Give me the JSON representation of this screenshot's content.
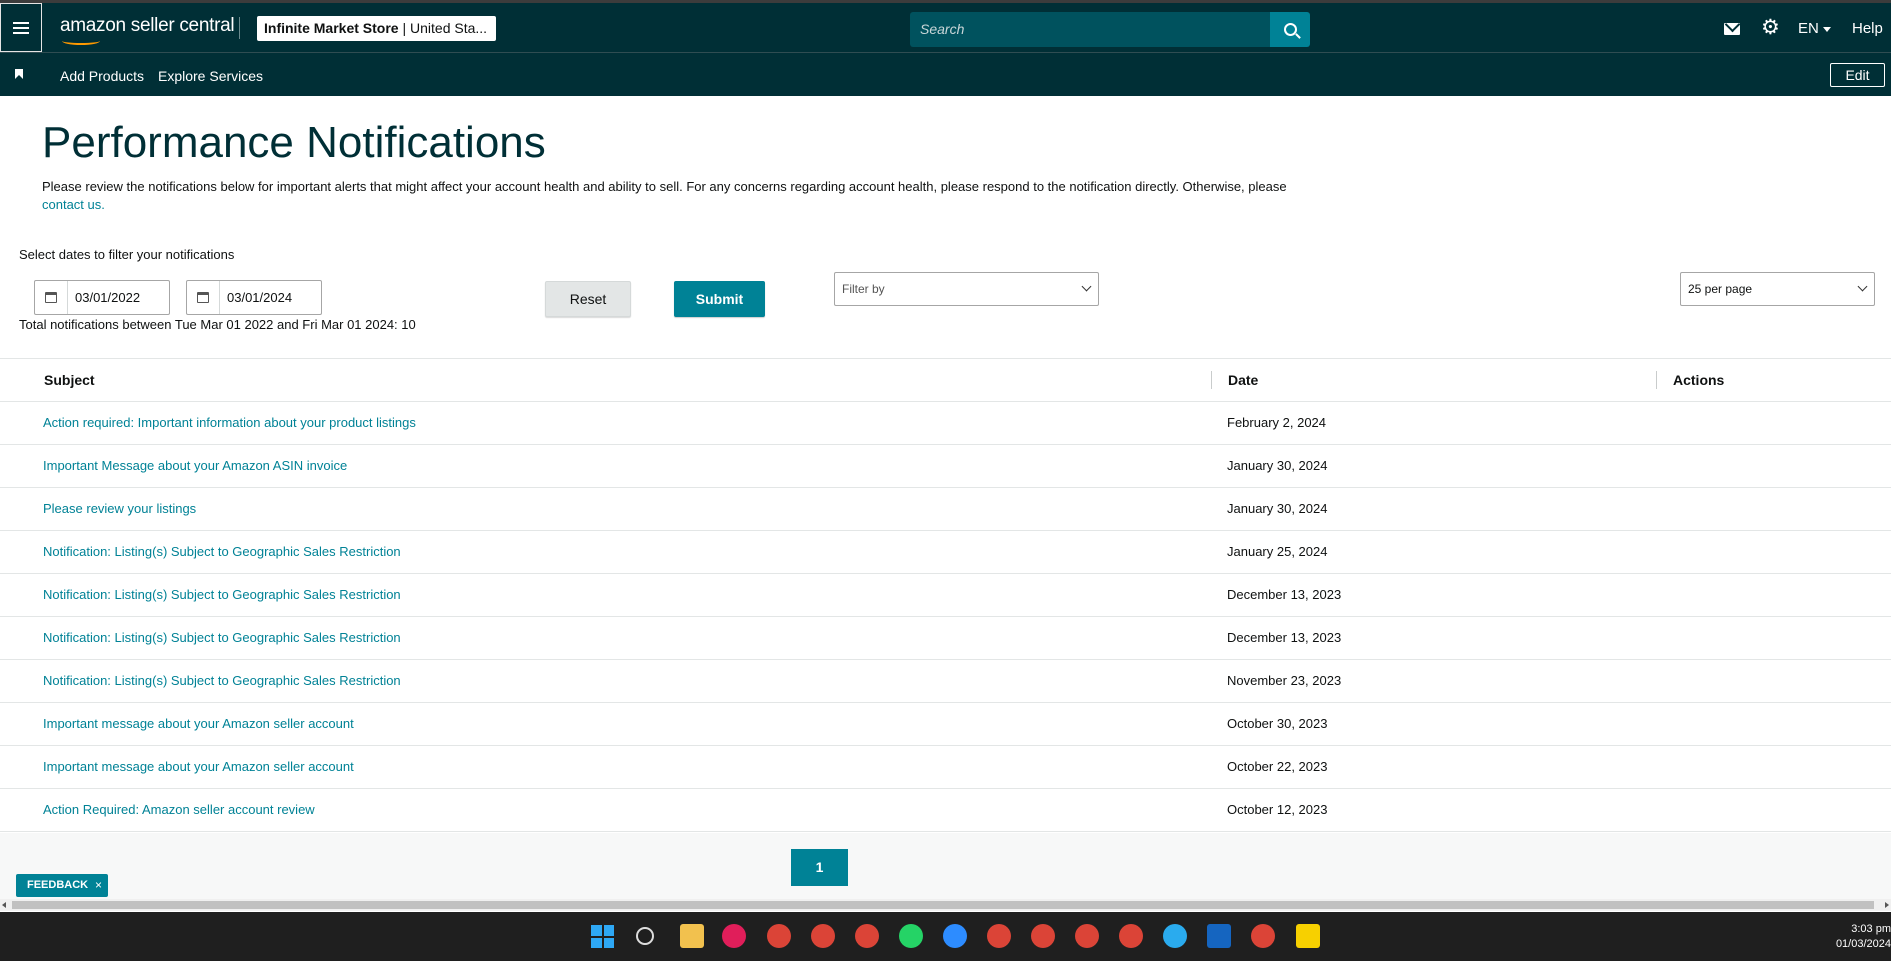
{
  "topbar": {
    "logo_text": "amazon seller central",
    "store_name": "Infinite Market Store",
    "store_region": "| United Sta...",
    "search_placeholder": "Search",
    "language": "EN",
    "help": "Help"
  },
  "navbar": {
    "links": [
      "Add Products",
      "Explore Services"
    ],
    "edit": "Edit"
  },
  "page": {
    "title": "Performance Notifications",
    "intro": "Please review the notifications below for important alerts that might affect your account health and ability to sell. For any concerns regarding account health, please respond to the notification directly. Otherwise, please",
    "contact_link": "contact us.",
    "filter_label": "Select dates to filter your notifications",
    "start_date": "03/01/2022",
    "end_date": "03/01/2024",
    "total_text": "Total notifications between Tue Mar 01 2022 and Fri Mar 01 2024: 10",
    "reset": "Reset",
    "submit": "Submit",
    "filter_by": "Filter by",
    "per_page": "25 per page"
  },
  "table": {
    "headers": [
      "Subject",
      "Date",
      "Actions"
    ],
    "rows": [
      {
        "subject": "Action required: Important information about your product listings",
        "date": "February 2, 2024"
      },
      {
        "subject": "Important Message about your Amazon ASIN invoice",
        "date": "January 30, 2024"
      },
      {
        "subject": "Please review your listings",
        "date": "January 30, 2024"
      },
      {
        "subject": "Notification: Listing(s) Subject to Geographic Sales Restriction",
        "date": "January 25, 2024"
      },
      {
        "subject": "Notification: Listing(s) Subject to Geographic Sales Restriction",
        "date": "December 13, 2023"
      },
      {
        "subject": "Notification: Listing(s) Subject to Geographic Sales Restriction",
        "date": "December 13, 2023"
      },
      {
        "subject": "Notification: Listing(s) Subject to Geographic Sales Restriction",
        "date": "November 23, 2023"
      },
      {
        "subject": "Important message about your Amazon seller account",
        "date": "October 30, 2023"
      },
      {
        "subject": "Important message about your Amazon seller account",
        "date": "October 22, 2023"
      },
      {
        "subject": "Action Required: Amazon seller account review",
        "date": "October 12, 2023"
      }
    ]
  },
  "pagination": {
    "current": "1"
  },
  "feedback": {
    "label": "FEEDBACK",
    "close": "×"
  },
  "taskbar": {
    "time": "3:03 pm",
    "date": "01/03/2024",
    "icons": [
      "windows-start-icon",
      "search-icon",
      "file-explorer-icon",
      "slack-icon",
      "chrome-icon",
      "chrome-icon",
      "chrome-icon",
      "whatsapp-icon",
      "zoom-icon",
      "chrome-icon",
      "chrome-icon",
      "chrome-icon",
      "chrome-icon",
      "telegram-icon",
      "r-app-icon",
      "chrome-icon",
      "sticky-notes-icon"
    ]
  },
  "colors": {
    "header_bg": "#002f36",
    "accent": "#008296",
    "link": "#008296",
    "title": "#002f36"
  }
}
